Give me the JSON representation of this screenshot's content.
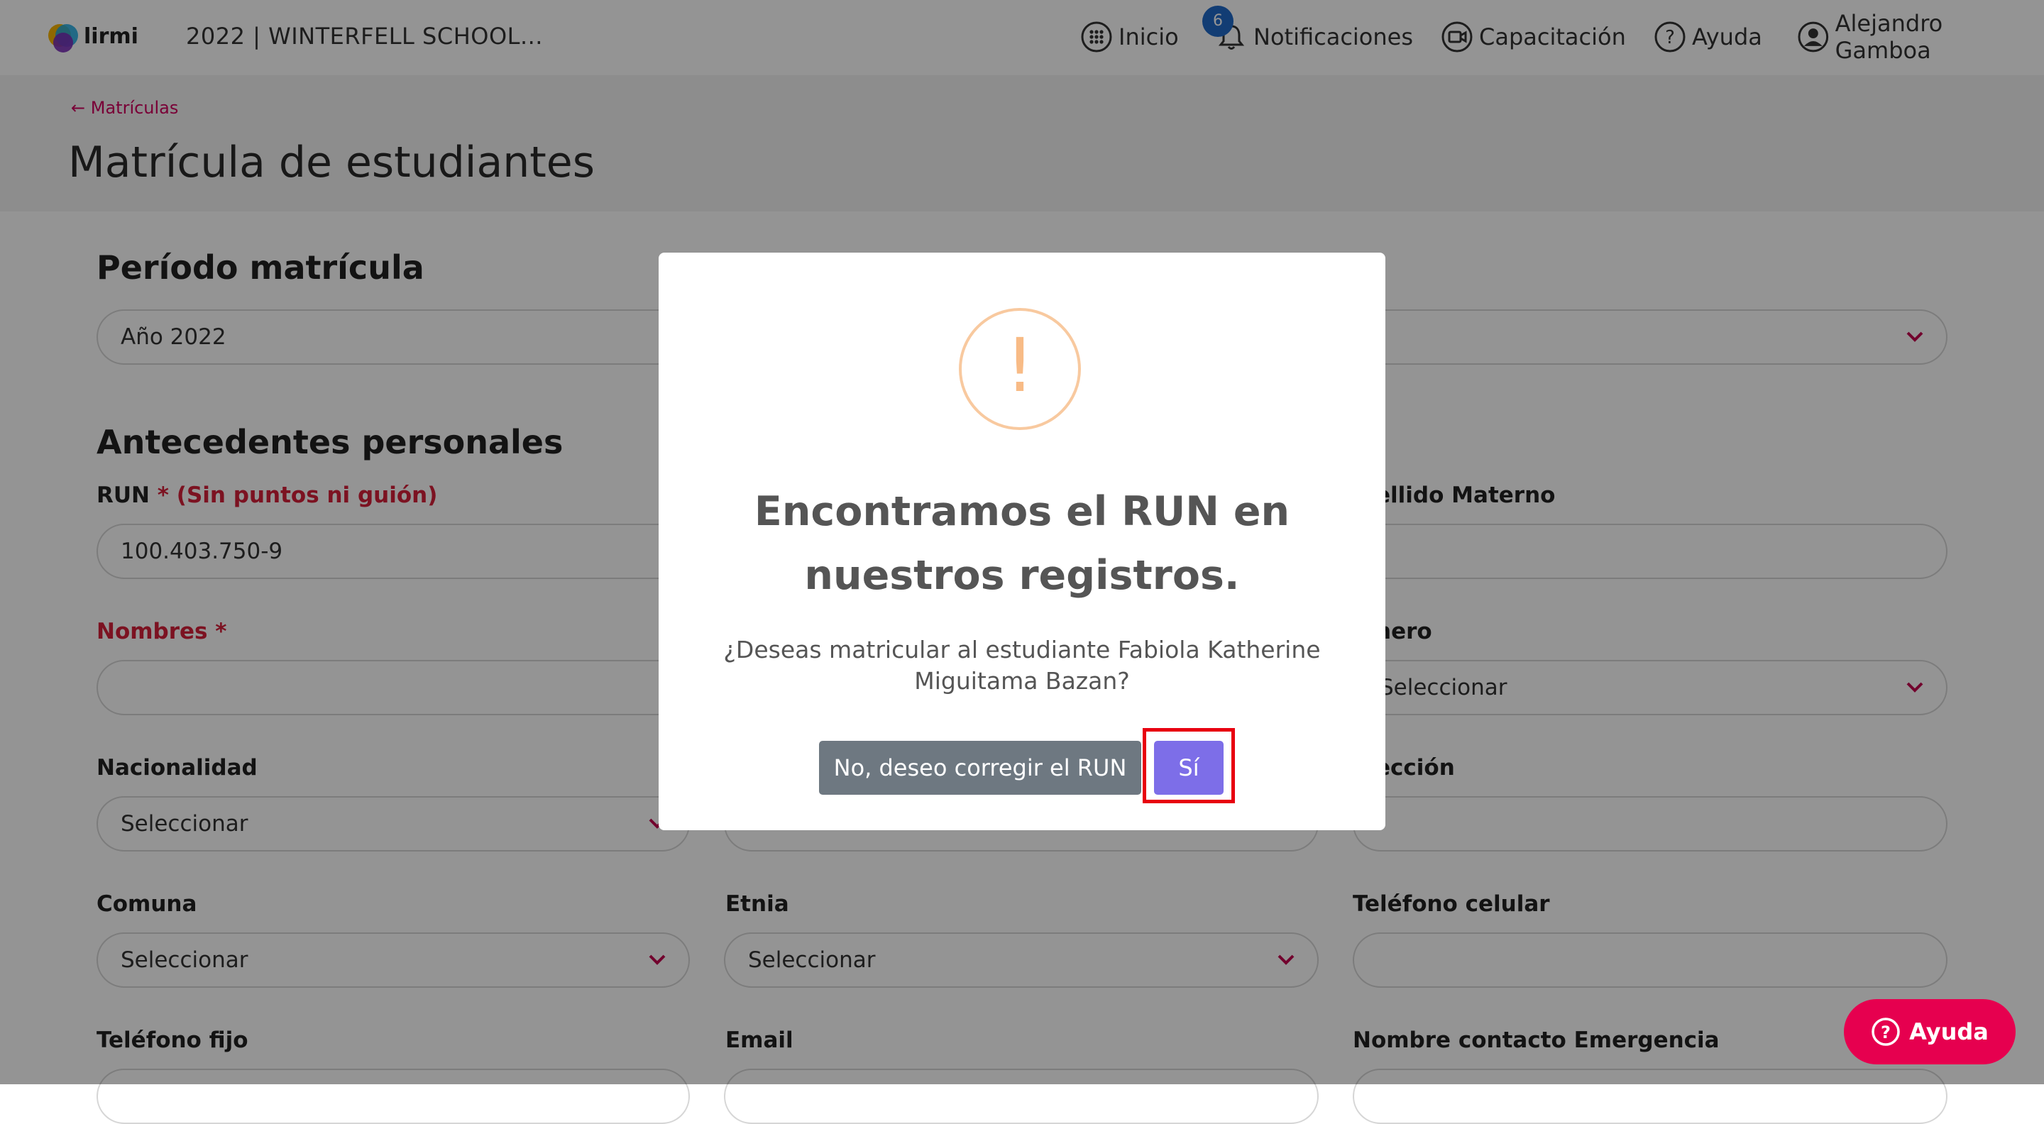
{
  "topbar": {
    "logo_text": "lirmi",
    "school": "2022  |  WINTERFELL SCHOOL...",
    "nav": {
      "inicio": "Inicio",
      "notificaciones": "Notificaciones",
      "notificaciones_count": "6",
      "capacitacion": "Capacitación",
      "ayuda": "Ayuda",
      "user": "Alejandro Gamboa"
    }
  },
  "header": {
    "back_link": "Matrículas",
    "title": "Matrícula de estudiantes"
  },
  "form": {
    "periodo_title": "Período matrícula",
    "periodo_value": "Año 2022",
    "antecedentes_title": "Antecedentes personales",
    "run_label": "RUN",
    "run_req": " * (Sin puntos ni guión)",
    "run_value": "100.403.750-9",
    "apellido_materno_label": "ellido Materno",
    "nombres_label": "Nombres *",
    "genero_label": "nero",
    "genero_value": "Seleccionar",
    "nacionalidad_label": "Nacionalidad",
    "nacionalidad_value": "Seleccionar",
    "direccion_label": "ección",
    "comuna_label": "Comuna",
    "comuna_value": "Seleccionar",
    "etnia_label": "Etnia",
    "etnia_value": "Seleccionar",
    "telefono_celular_label": "Teléfono celular",
    "telefono_fijo_label": "Teléfono fijo",
    "email_label": "Email",
    "contacto_emergencia_label": "Nombre contacto Emergencia"
  },
  "modal": {
    "title": "Encontramos el RUN en nuestros registros.",
    "text": "¿Deseas matricular al estudiante Fabiola Katherine Miguitama Bazan?",
    "btn_no": "No, deseo corregir el RUN",
    "btn_yes": "Sí"
  },
  "help_button": "Ayuda",
  "colors": {
    "accent": "#d1005e",
    "primary_button": "#7d6ee8",
    "secondary_button": "#6e7881",
    "warning_icon": "#f8bb86",
    "highlight_box": "#e8000f"
  }
}
